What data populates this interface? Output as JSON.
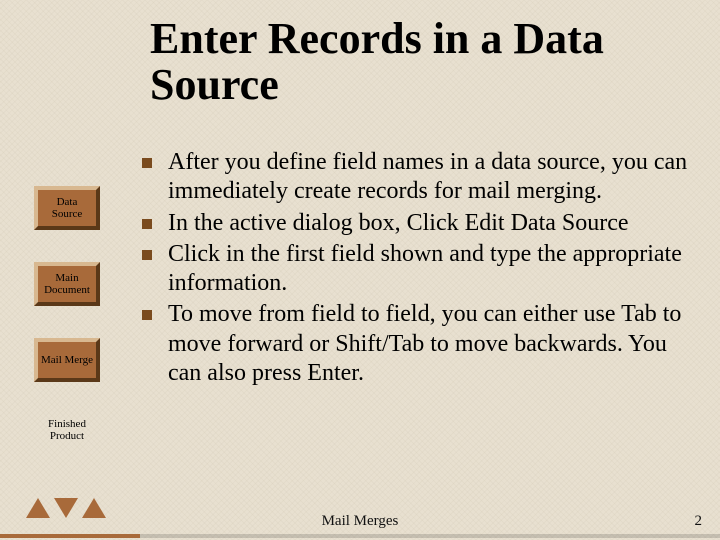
{
  "title": "Enter Records in a Data Source",
  "sidebar": {
    "items": [
      {
        "label": "Data Source"
      },
      {
        "label": "Main Document"
      },
      {
        "label": "Mail Merge"
      },
      {
        "label": "Finished Product"
      }
    ]
  },
  "bullets": [
    "After you define field names in a data source, you can immediately create records for mail merging.",
    "In the active dialog box, Click Edit Data Source",
    "Click in the first field shown and type the appropriate information.",
    "To move from field to field, you can either use Tab to move forward or Shift/Tab to move backwards.  You can also press Enter."
  ],
  "footer": {
    "label": "Mail Merges",
    "page": "2"
  }
}
